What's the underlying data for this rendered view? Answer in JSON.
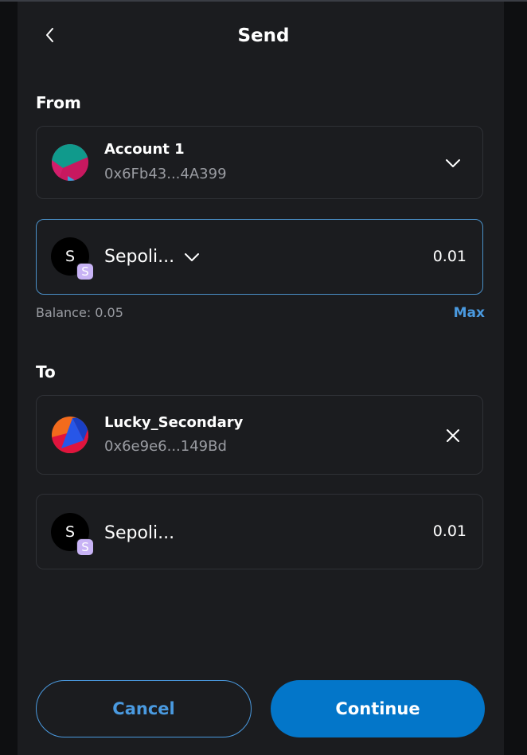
{
  "header": {
    "title": "Send"
  },
  "from": {
    "label": "From",
    "account": {
      "name": "Account 1",
      "address": "0x6Fb43...4A399"
    },
    "token": {
      "icon_letter": "S",
      "badge_letter": "S",
      "name": "Sepoli...",
      "amount": "0.01"
    },
    "balance": "Balance: 0.05",
    "max_label": "Max"
  },
  "to": {
    "label": "To",
    "account": {
      "name": "Lucky_Secondary",
      "address": "0x6e9e6...149Bd"
    },
    "token": {
      "icon_letter": "S",
      "badge_letter": "S",
      "name": "Sepoli...",
      "amount": "0.01"
    }
  },
  "footer": {
    "cancel_label": "Cancel",
    "continue_label": "Continue"
  },
  "icons": {
    "back": "chevron-left-icon",
    "from_dropdown": "chevron-down-icon",
    "token_dropdown": "chevron-down-icon",
    "clear": "close-icon"
  },
  "colors": {
    "accent": "#4a9ae0",
    "primary_button": "#0376c9",
    "active_border": "#4a90c8",
    "token_badge": "#c8b3f5"
  }
}
